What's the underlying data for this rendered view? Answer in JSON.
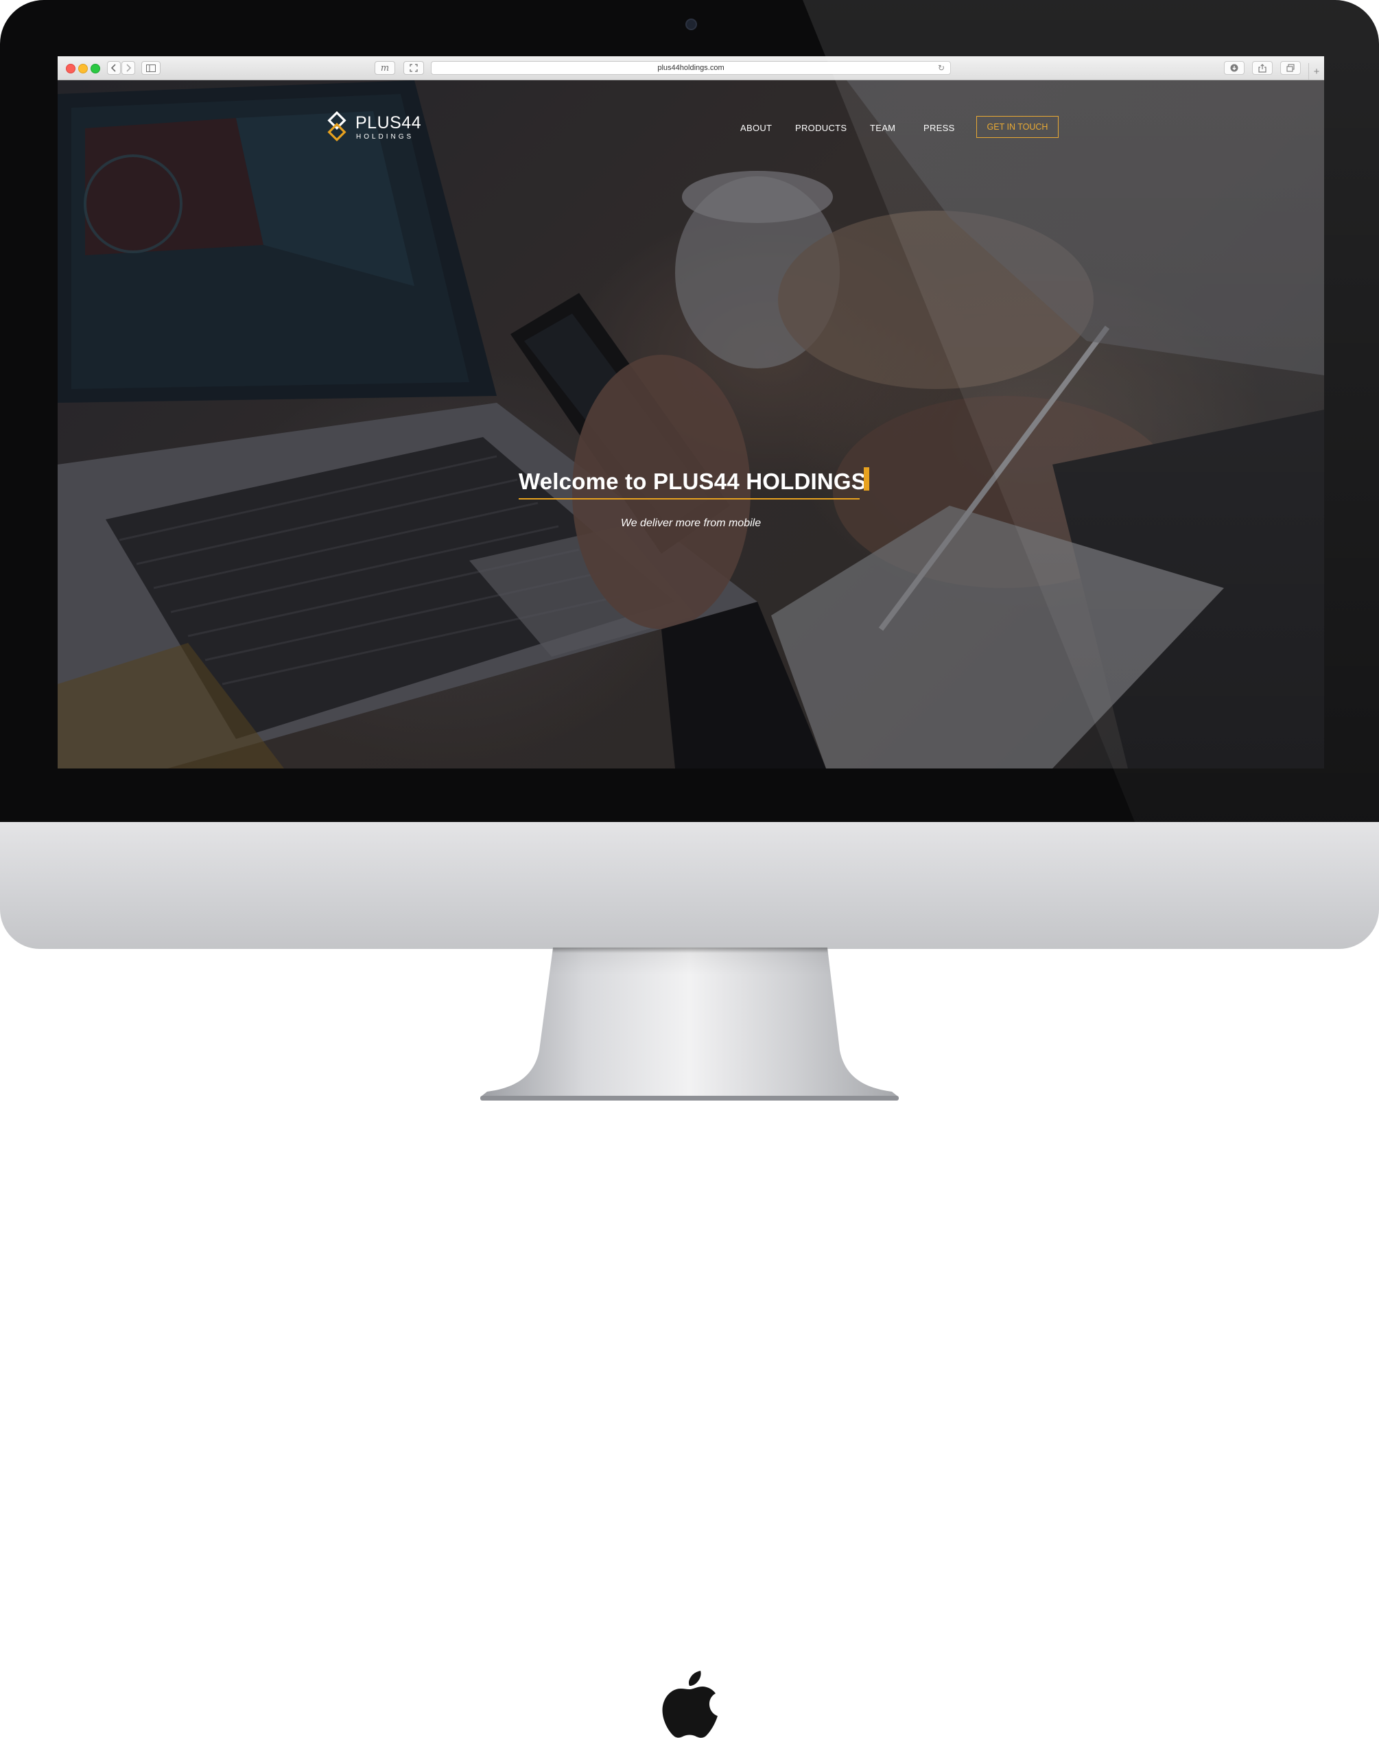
{
  "browser": {
    "url": "plus44holdings.com",
    "icons": {
      "back": "chevron-left-icon",
      "forward": "chevron-right-icon",
      "sidebar": "sidebar-icon",
      "extension": "m-extension-icon",
      "fullscreen": "expand-icon",
      "reload": "reload-icon",
      "downloads": "download-icon",
      "share": "share-icon",
      "tabs": "tabs-overview-icon",
      "new_tab": "plus-icon"
    }
  },
  "site": {
    "logo": {
      "name": "PLUS44",
      "sub": "HOLDINGS"
    },
    "nav": {
      "items": [
        "ABOUT",
        "PRODUCTS",
        "TEAM",
        "PRESS"
      ],
      "cta": "GET IN TOUCH"
    },
    "hero": {
      "title": "Welcome to PLUS44 HOLDINGS",
      "tagline": "We deliver more from mobile"
    },
    "colors": {
      "accent": "#e8a21f",
      "text": "#ffffff"
    }
  }
}
